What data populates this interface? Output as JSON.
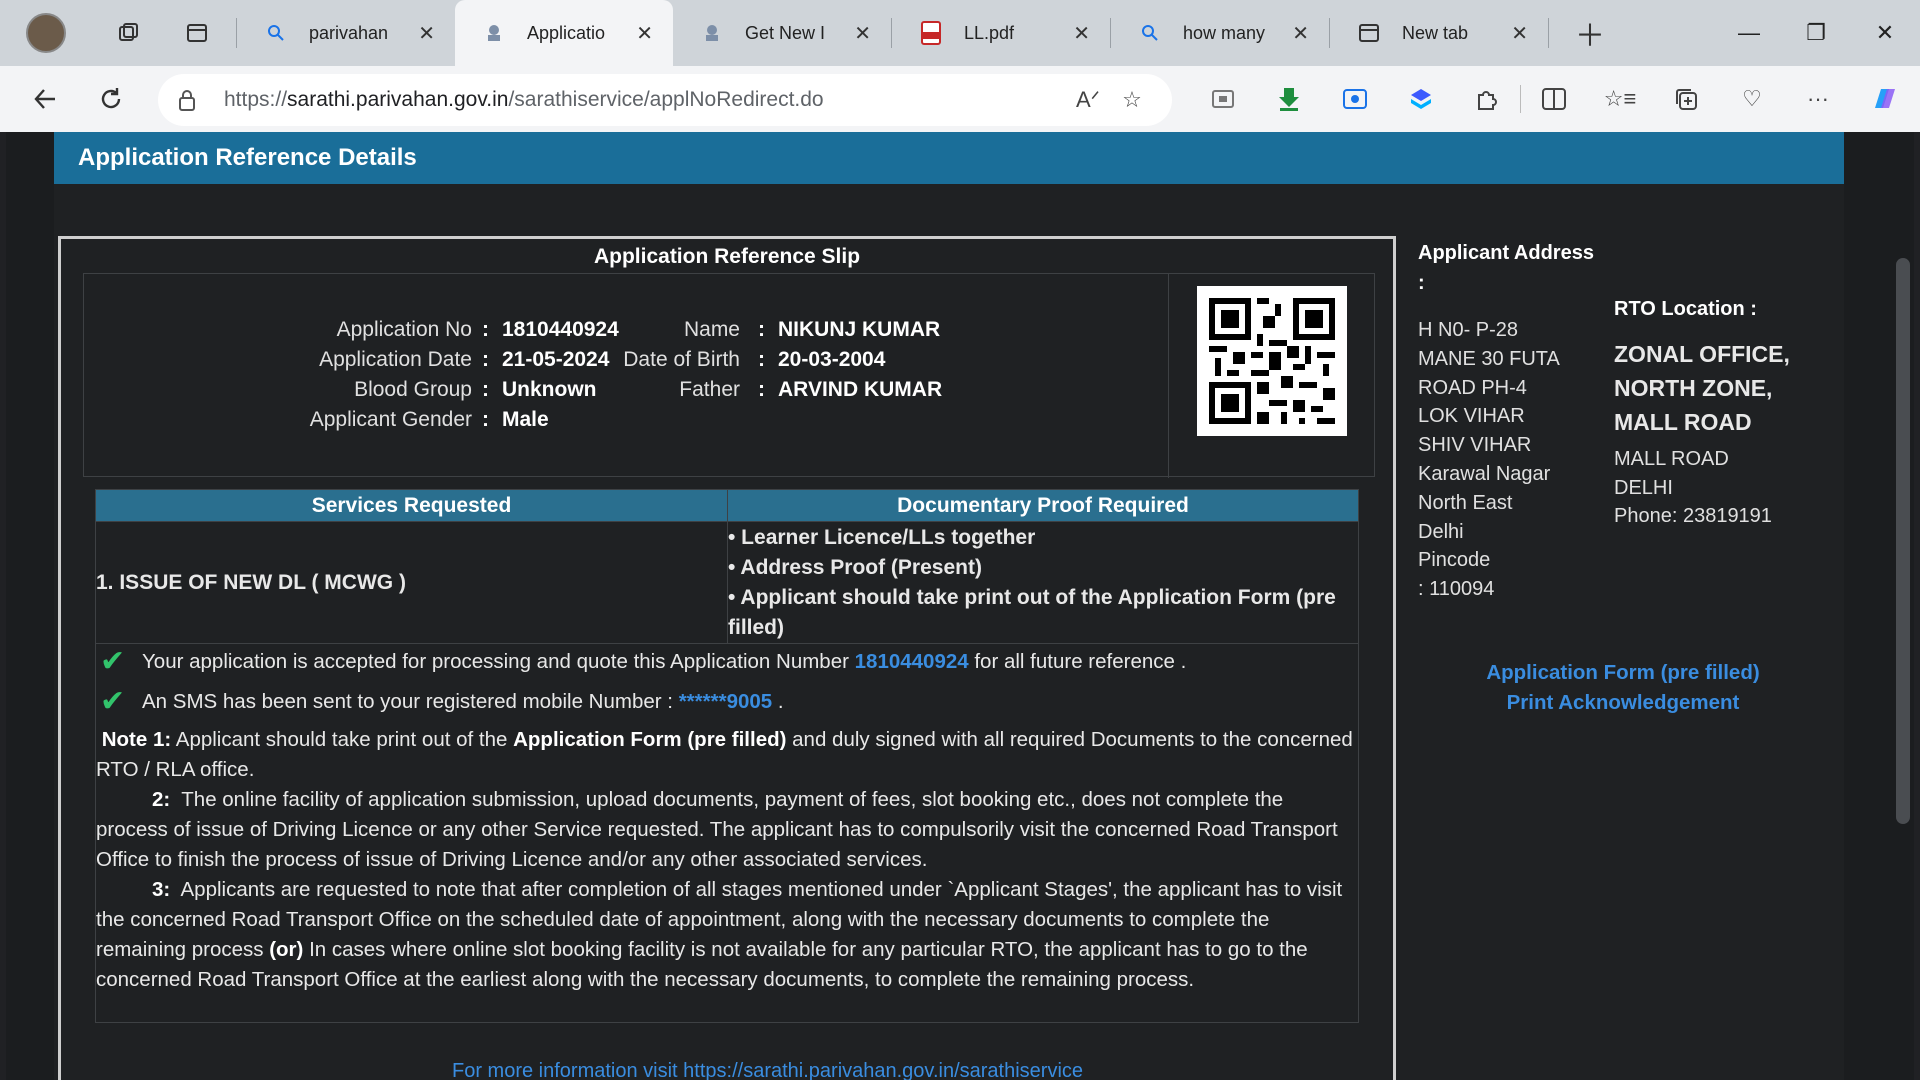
{
  "tabs": [
    {
      "label": "parivahan",
      "icon": "search-icon"
    },
    {
      "label": "Applicatio",
      "icon": "emblem-icon"
    },
    {
      "label": "Get New I",
      "icon": "emblem-icon"
    },
    {
      "label": "LL.pdf",
      "icon": "pdf-icon"
    },
    {
      "label": "how many",
      "icon": "search-icon"
    },
    {
      "label": "New tab",
      "icon": "newtab-icon"
    }
  ],
  "address_bar": {
    "scheme": "https://",
    "host": "sarathi.parivahan.gov.in",
    "path": "/sarathiservice/applNoRedirect.do"
  },
  "page": {
    "header": "Application Reference Details",
    "slip_title": "Application Reference Slip",
    "fields": {
      "application_no": {
        "label": "Application No",
        "value": "1810440924"
      },
      "application_date": {
        "label": "Application Date",
        "value": "21-05-2024"
      },
      "blood_group": {
        "label": "Blood Group",
        "value": "Unknown"
      },
      "gender": {
        "label": "Applicant Gender",
        "value": "Male"
      },
      "name": {
        "label": "Name",
        "value": "NIKUNJ KUMAR"
      },
      "dob": {
        "label": "Date of Birth",
        "value": "20-03-2004"
      },
      "father": {
        "label": "Father",
        "value": "ARVIND KUMAR"
      }
    },
    "colon": ":",
    "services_table": {
      "headers": [
        "Services Requested",
        "Documentary Proof Required"
      ],
      "service": "1. ISSUE OF NEW DL ( MCWG )",
      "documents": [
        "• Learner Licence/LLs together",
        "• Address Proof (Present)",
        "• Applicant should take print out of the Application Form (pre filled)"
      ]
    },
    "messages": {
      "accepted_pre": "Your application is accepted for processing and quote this Application Number",
      "accepted_num": "1810440924",
      "accepted_post": "for all future reference .",
      "sms_pre": "An SMS has been sent to your registered mobile Number :",
      "sms_num": "******9005",
      "sms_post": "."
    },
    "notes": {
      "n1_label": "Note 1:",
      "n1_a": "Applicant should take print out of the",
      "n1_bold": "Application Form (pre filled)",
      "n1_b": "and duly signed with all required Documents to the concerned RTO / RLA office.",
      "n2_label": "2:",
      "n2_text": "The online facility of application submission, upload documents, payment of fees, slot booking etc., does not complete the process of issue of Driving Licence or any other Service requested. The applicant has to compulsorily visit the concerned Road Transport Office to finish the process of issue of Driving Licence and/or any other associated services.",
      "n3_label": "3:",
      "n3_a": "Applicants are requested to note that after completion of all stages mentioned under `Applicant Stages', the applicant has to visit the concerned Road Transport Office on the scheduled date of appointment, along with the necessary documents to complete the remaining process",
      "n3_bold": "(or)",
      "n3_b": "In cases where online slot booking facility is not available for any particular RTO, the applicant has to go to the concerned Road Transport Office at the earliest along with the necessary documents, to complete the remaining process."
    },
    "bottom_link": "For more information visit https://sarathi.parivahan.gov.in/sarathiservice",
    "applicant_address": {
      "heading": "Applicant Address :",
      "lines": [
        "H N0- P-28",
        "MANE 30 FUTA",
        "ROAD PH-4",
        "LOK VIHAR",
        "SHIV VIHAR",
        "Karawal Nagar",
        "North East",
        "Delhi",
        "Pincode",
        ": 110094"
      ]
    },
    "rto_location": {
      "heading": "RTO Location :",
      "office_lines": [
        "ZONAL OFFICE,",
        "NORTH ZONE,",
        "MALL ROAD"
      ],
      "lines": [
        "MALL ROAD",
        "DELHI",
        "Phone:  23819191"
      ]
    },
    "links": {
      "application_form": "Application Form (pre filled)",
      "print_ack": "Print Acknowledgement"
    }
  },
  "colors": {
    "header_blue": "#1a6e99",
    "table_header": "#2a6f8f",
    "link_blue": "#3a8de0",
    "check_green": "#32c36b"
  }
}
